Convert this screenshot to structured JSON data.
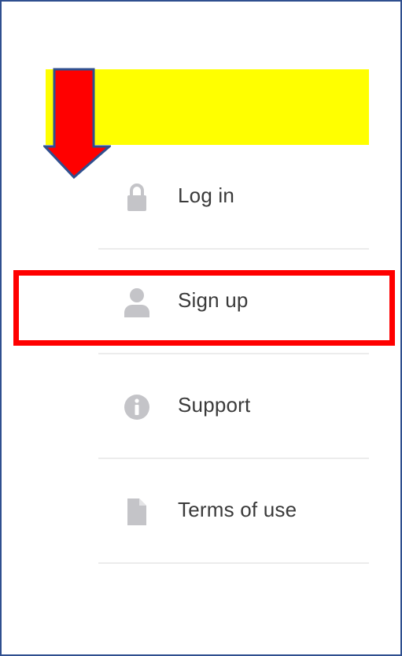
{
  "menu": {
    "items": [
      {
        "label": "Log in",
        "icon": "lock-icon"
      },
      {
        "label": "Sign up",
        "icon": "user-icon"
      },
      {
        "label": "Support",
        "icon": "info-icon"
      },
      {
        "label": "Terms of use",
        "icon": "document-icon"
      }
    ]
  },
  "colors": {
    "highlight": "#ffff00",
    "arrow": "#ff0000",
    "arrow_outline": "#2f4f8f",
    "callout": "#ff0000",
    "icon": "#c4c4c8",
    "text": "#3a3a3a",
    "frame": "#2f4f8f"
  }
}
